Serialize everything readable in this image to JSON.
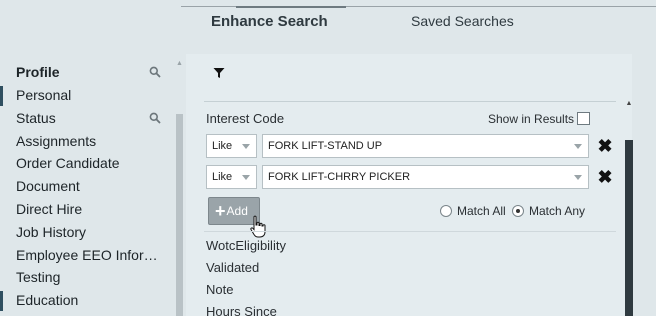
{
  "tabs": {
    "enhance": "Enhance Search",
    "saved": "Saved Searches"
  },
  "sidebar": {
    "items": [
      {
        "label": "Profile",
        "bold": true,
        "search": true
      },
      {
        "label": "Personal"
      },
      {
        "label": "Status",
        "search": true
      },
      {
        "label": "Assignments"
      },
      {
        "label": "Order Candidate"
      },
      {
        "label": "Document"
      },
      {
        "label": "Direct Hire"
      },
      {
        "label": "Job History"
      },
      {
        "label": "Employee EEO Infor…"
      },
      {
        "label": "Testing"
      },
      {
        "label": "Education"
      }
    ]
  },
  "criteria": {
    "field_label": "Interest Code",
    "show_in_results": "Show in Results",
    "rows": [
      {
        "operator": "Like",
        "value": "FORK LIFT-STAND UP"
      },
      {
        "operator": "Like",
        "value": "FORK LIFT-CHRRY PICKER"
      }
    ],
    "add_label": "Add",
    "match_all": "Match All",
    "match_any": "Match Any",
    "selected_match": "match_any"
  },
  "fields": [
    "WotcEligibility",
    "Validated",
    "Note",
    "Hours Since"
  ],
  "icons": {
    "filter": "filter-icon",
    "search": "search-icon",
    "remove": "close-icon",
    "add": "plus-icon",
    "cursor": "hand-pointer-icon"
  },
  "colors": {
    "background": "#dfe7ea",
    "panel": "#e4ecef",
    "add_button": "#9aa4a9",
    "scroll_thumb": "#2f3a40"
  }
}
